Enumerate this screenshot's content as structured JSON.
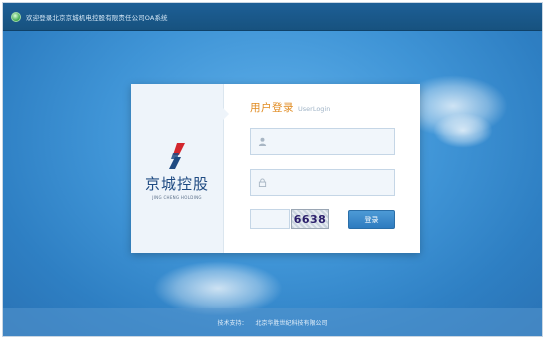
{
  "header": {
    "welcome_text": "欢迎登录北京京城机电控股有限责任公司OA系统"
  },
  "brand": {
    "name_cn": "京城控股",
    "name_en": "JING CHENG HOLDING"
  },
  "login": {
    "title_cn": "用户登录",
    "title_en": "UserLogin",
    "username_placeholder": "",
    "password_placeholder": "",
    "captcha_value": "",
    "captcha_code": "6638",
    "submit_label": "登录"
  },
  "footer": {
    "support_label": "技术支持：",
    "support_company": "北京华胜世纪科技有限公司"
  },
  "colors": {
    "accent_title": "#e08a1f",
    "button": "#3a8bcd",
    "topbar": "#1b5a8e"
  },
  "icons": {
    "user_field": "user-icon",
    "password_field": "lock-icon",
    "status": "green-dot-icon"
  }
}
